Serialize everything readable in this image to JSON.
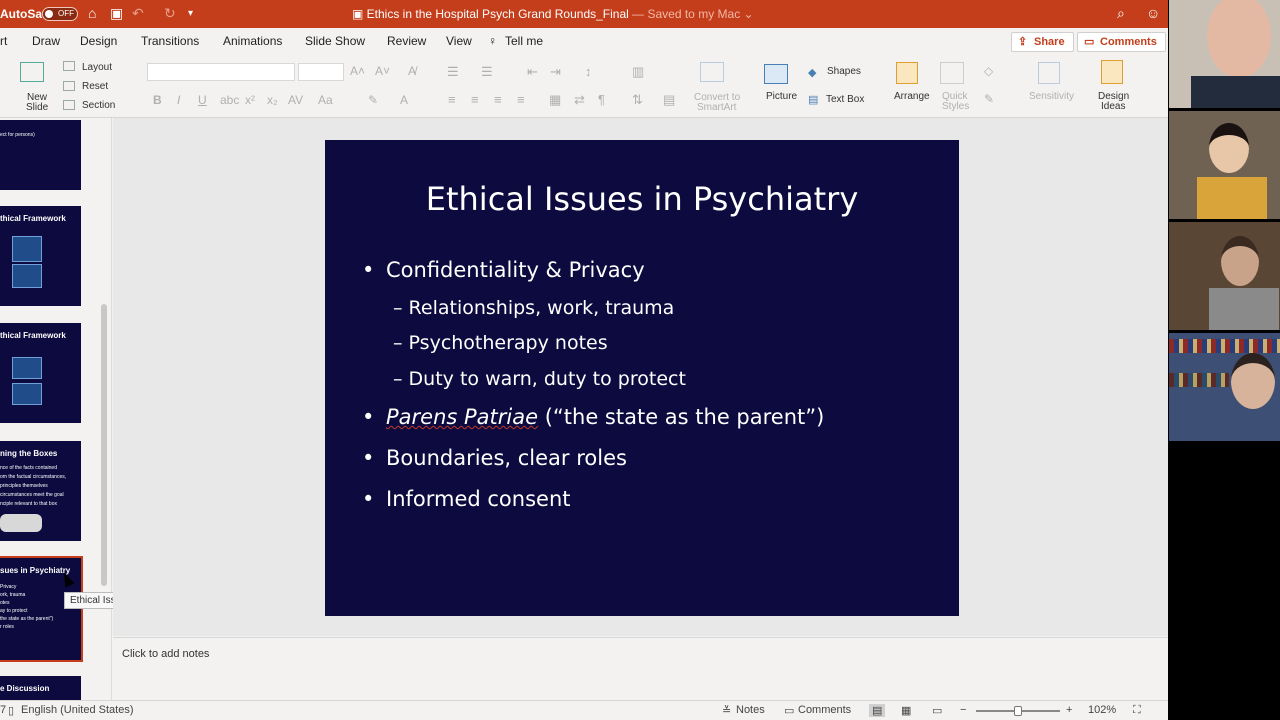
{
  "titlebar": {
    "autosave_label": "AutoSave",
    "autosave_state": "OFF",
    "doc_title": "Ethics in the Hospital Psych Grand Rounds_Final",
    "saved_status": "— Saved to my Mac ⌄"
  },
  "menu": [
    "rt",
    "Draw",
    "Design",
    "Transitions",
    "Animations",
    "Slide Show",
    "Review",
    "View",
    "Tell me"
  ],
  "actions": {
    "share": "Share",
    "comments": "Comments"
  },
  "ribbon": {
    "new_slide": [
      "New",
      "Slide"
    ],
    "layout": "Layout",
    "reset": "Reset",
    "section": "Section",
    "convert_smartart": [
      "Convert to",
      "SmartArt"
    ],
    "picture": "Picture",
    "shapes": "Shapes",
    "text_box": "Text Box",
    "arrange": "Arrange",
    "quick_styles": [
      "Quick",
      "Styles"
    ],
    "sensitivity": "Sensitivity",
    "design_ideas": [
      "Design",
      "Ideas"
    ]
  },
  "thumbnails": [
    {
      "title": "",
      "lines": [
        "ect for persons)"
      ]
    },
    {
      "title": "thical Framework",
      "lines": []
    },
    {
      "title": "thical Framework",
      "lines": []
    },
    {
      "title": "ning the Boxes",
      "lines": [
        "nce of the facts contained",
        "om the factual circumstances,",
        "principles themselves",
        "circumstances meet the goal",
        "nciple relevant to that box"
      ]
    },
    {
      "title": "sues in Psychiatry",
      "lines": [
        "Privacy",
        "ork, trauma",
        "otes",
        "ay to protect",
        "the state as the parent\")",
        "r roles"
      ]
    },
    {
      "title": "e Discussion",
      "lines": []
    }
  ],
  "tooltip": "Ethical Issues in Psychiatry",
  "slide": {
    "title": "Ethical Issues in Psychiatry",
    "bullet_char": "•",
    "dash_char": "–",
    "b1": "Confidentiality & Privacy",
    "s1": "Relationships, work, trauma",
    "s2": "Psychotherapy notes",
    "s3": "Duty to warn, duty to protect",
    "b2_italic": "Parens Patriae",
    "b2_rest": " (“the state as the parent”)",
    "b3": "Boundaries, clear roles",
    "b4": "Informed consent"
  },
  "notes_placeholder": "Click to add notes",
  "status": {
    "slide_indicator": "7",
    "language": "English (United States)",
    "notes": "Notes",
    "comments": "Comments",
    "zoom": "102%"
  }
}
